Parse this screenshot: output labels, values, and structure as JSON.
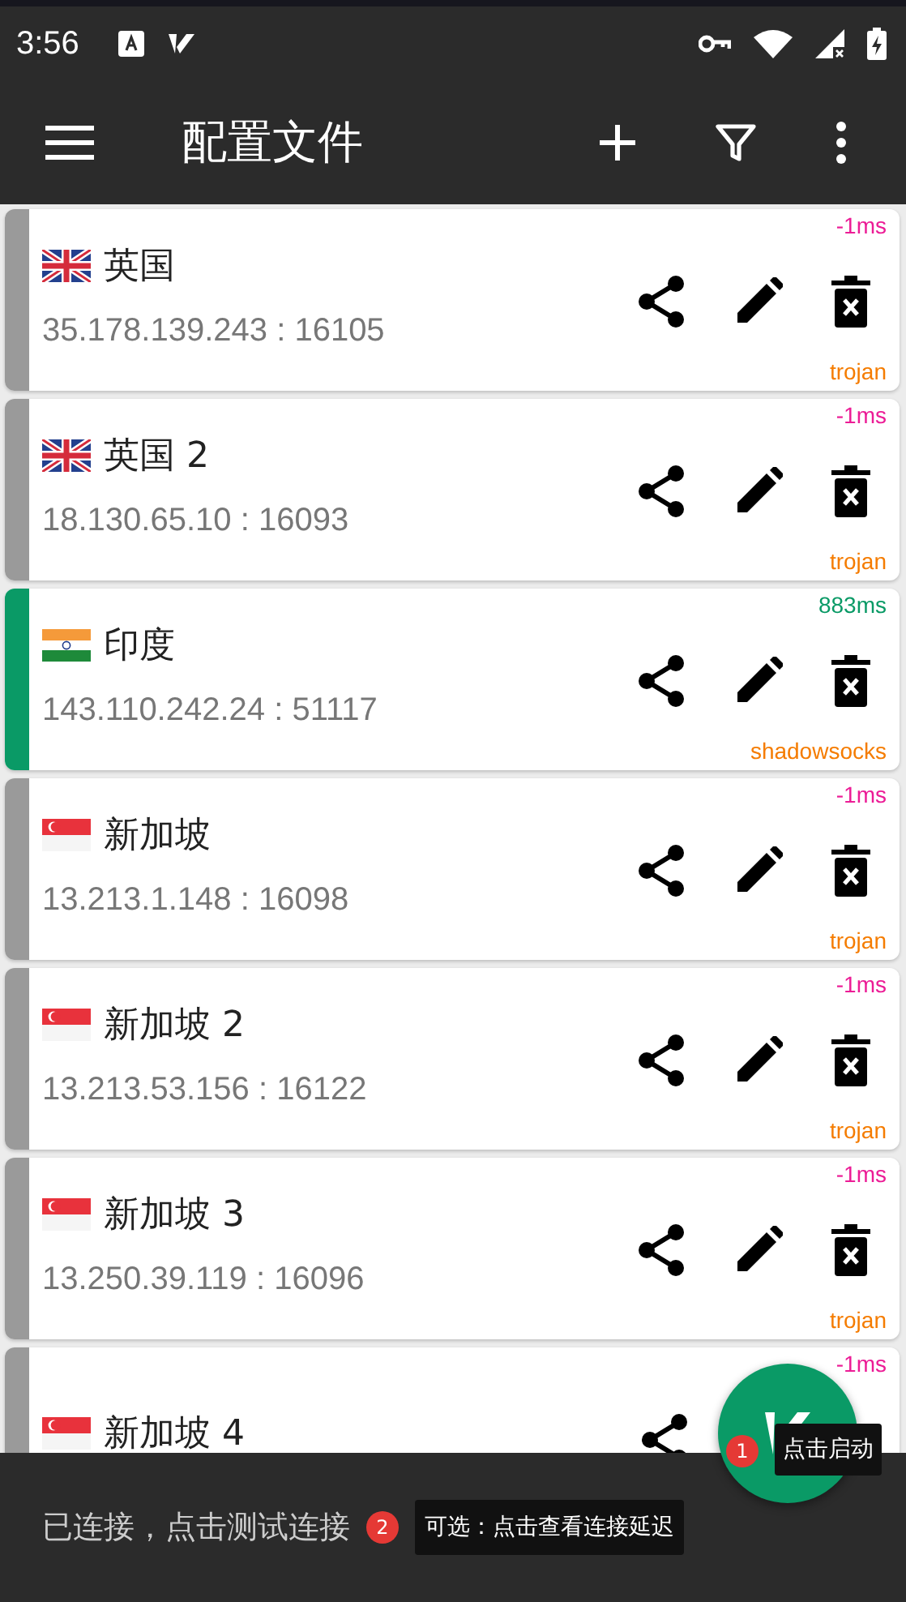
{
  "status_bar": {
    "time": "3:56"
  },
  "toolbar": {
    "title": "配置文件"
  },
  "servers": [
    {
      "kind": "uk",
      "name": "英国",
      "address": "35.178.139.243 : 16105",
      "latency": "-1ms",
      "color": "#ec1c96",
      "type": "trojan",
      "selected": false
    },
    {
      "kind": "uk",
      "name": "英国 2",
      "address": "18.130.65.10 : 16093",
      "latency": "-1ms",
      "color": "#ec1c96",
      "type": "trojan",
      "selected": false
    },
    {
      "kind": "india",
      "name": "印度",
      "address": "143.110.242.24 : 51117",
      "latency": "883ms",
      "color": "#0a9a66",
      "type": "shadowsocks",
      "selected": true
    },
    {
      "kind": "singapore",
      "name": "新加坡",
      "address": "13.213.1.148 : 16098",
      "latency": "-1ms",
      "color": "#ec1c96",
      "type": "trojan",
      "selected": false
    },
    {
      "kind": "singapore",
      "name": "新加坡 2",
      "address": "13.213.53.156 : 16122",
      "latency": "-1ms",
      "color": "#ec1c96",
      "type": "trojan",
      "selected": false
    },
    {
      "kind": "singapore",
      "name": "新加坡 3",
      "address": "13.250.39.119 : 16096",
      "latency": "-1ms",
      "color": "#ec1c96",
      "type": "trojan",
      "selected": false
    },
    {
      "kind": "singapore",
      "name": "新加坡 4",
      "latency": "-1ms",
      "color": "#ec1c96",
      "selected": false
    }
  ],
  "fab": {
    "tip_number": "1",
    "tip": "点击启动"
  },
  "bottom_bar": {
    "status": "已连接，点击测试连接",
    "tip_number": "2",
    "tip": "可选：点击查看连接延迟"
  }
}
